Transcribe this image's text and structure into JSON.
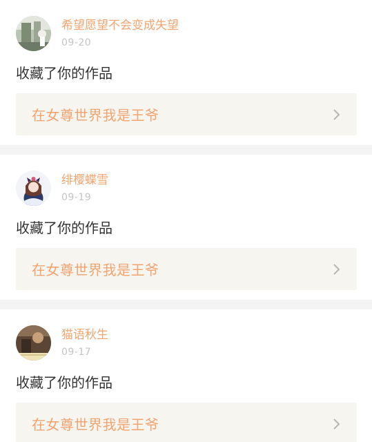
{
  "feed": {
    "items": [
      {
        "username": "希望愿望不会变成失望",
        "date": "09-20",
        "action": "收藏了你的作品",
        "work_title": "在女尊世界我是王爷",
        "avatar_icon": "avatar-photo-icon"
      },
      {
        "username": "绯樱蝶雪",
        "date": "09-19",
        "action": "收藏了你的作品",
        "work_title": "在女尊世界我是王爷",
        "avatar_icon": "avatar-anime-icon"
      },
      {
        "username": "猫语秋生",
        "date": "09-17",
        "action": "收藏了你的作品",
        "work_title": "在女尊世界我是王爷",
        "avatar_icon": "avatar-photo-icon"
      }
    ]
  },
  "colors": {
    "accent": "#f0a470",
    "date": "#c4c4c4",
    "text": "#333333",
    "link_bg": "#f6f5f0",
    "divider": "#f4f4f4"
  }
}
